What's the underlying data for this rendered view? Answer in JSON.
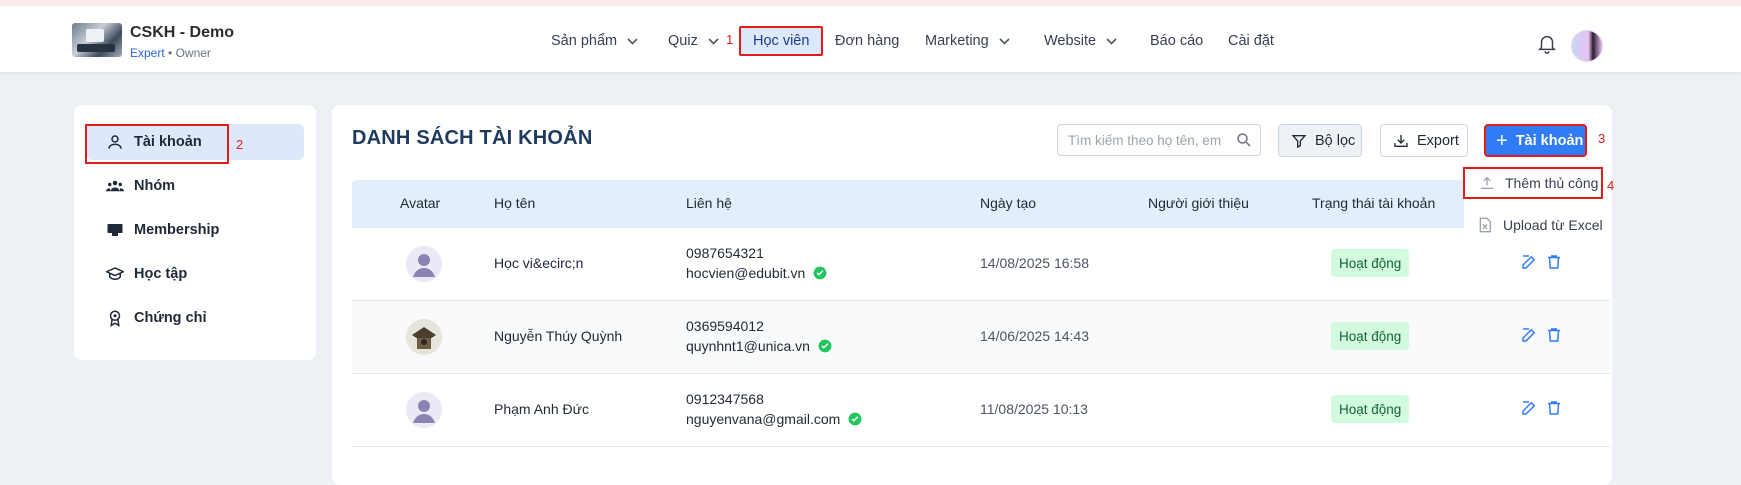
{
  "brand": {
    "title": "CSKH - Demo",
    "plan": "Expert",
    "role": "• Owner"
  },
  "nav": {
    "items": [
      {
        "label": "Sản phẩm"
      },
      {
        "label": "Quiz"
      },
      {
        "label": "Học viên"
      },
      {
        "label": "Đơn hàng"
      },
      {
        "label": "Marketing"
      },
      {
        "label": "Website"
      },
      {
        "label": "Báo cáo"
      },
      {
        "label": "Cài đặt"
      }
    ]
  },
  "annotations": {
    "a1": "1",
    "a2": "2",
    "a3": "3",
    "a4": "4"
  },
  "sidebar": {
    "items": [
      {
        "label": "Tài khoản",
        "icon": "user-icon"
      },
      {
        "label": "Nhóm",
        "icon": "group-icon"
      },
      {
        "label": "Membership",
        "icon": "membership-icon"
      },
      {
        "label": "Học tập",
        "icon": "graduation-cap-icon"
      },
      {
        "label": "Chứng chỉ",
        "icon": "certificate-icon"
      }
    ]
  },
  "main": {
    "title": "DANH SÁCH TÀI KHOẢN",
    "search_placeholder": "Tìm kiếm theo họ tên, em",
    "filter_label": "Bộ lọc",
    "export_label": "Export",
    "add_label": "Tài khoản"
  },
  "table": {
    "columns": [
      "Avatar",
      "Họ tên",
      "Liên hệ",
      "Ngày tạo",
      "Người giới thiệu",
      "Trạng thái tài khoản"
    ],
    "rows": [
      {
        "name": "Học vi&ecirc;n",
        "phone": "0987654321",
        "email": "hocvien@edubit.vn",
        "created": "14/08/2025 16:58",
        "referrer": "",
        "status": "Hoạt động"
      },
      {
        "name": "Nguyễn Thúy Quỳnh",
        "phone": "0369594012",
        "email": "quynhnt1@unica.vn",
        "created": "14/06/2025 14:43",
        "referrer": "",
        "status": "Hoạt động"
      },
      {
        "name": "Phạm Anh Đức",
        "phone": "0912347568",
        "email": "nguyenvana@gmail.com",
        "created": "11/08/2025 10:13",
        "referrer": "",
        "status": "Hoạt động"
      }
    ]
  },
  "dropdown": {
    "items": [
      {
        "label": "Thêm thủ công",
        "icon": "upload-icon"
      },
      {
        "label": "Upload từ Excel",
        "icon": "excel-file-icon"
      }
    ]
  },
  "colors": {
    "primary": "#2f7cf6",
    "annotation": "#e21b1b",
    "status_bg": "#d1fadf",
    "header_row": "#e3eefb"
  }
}
